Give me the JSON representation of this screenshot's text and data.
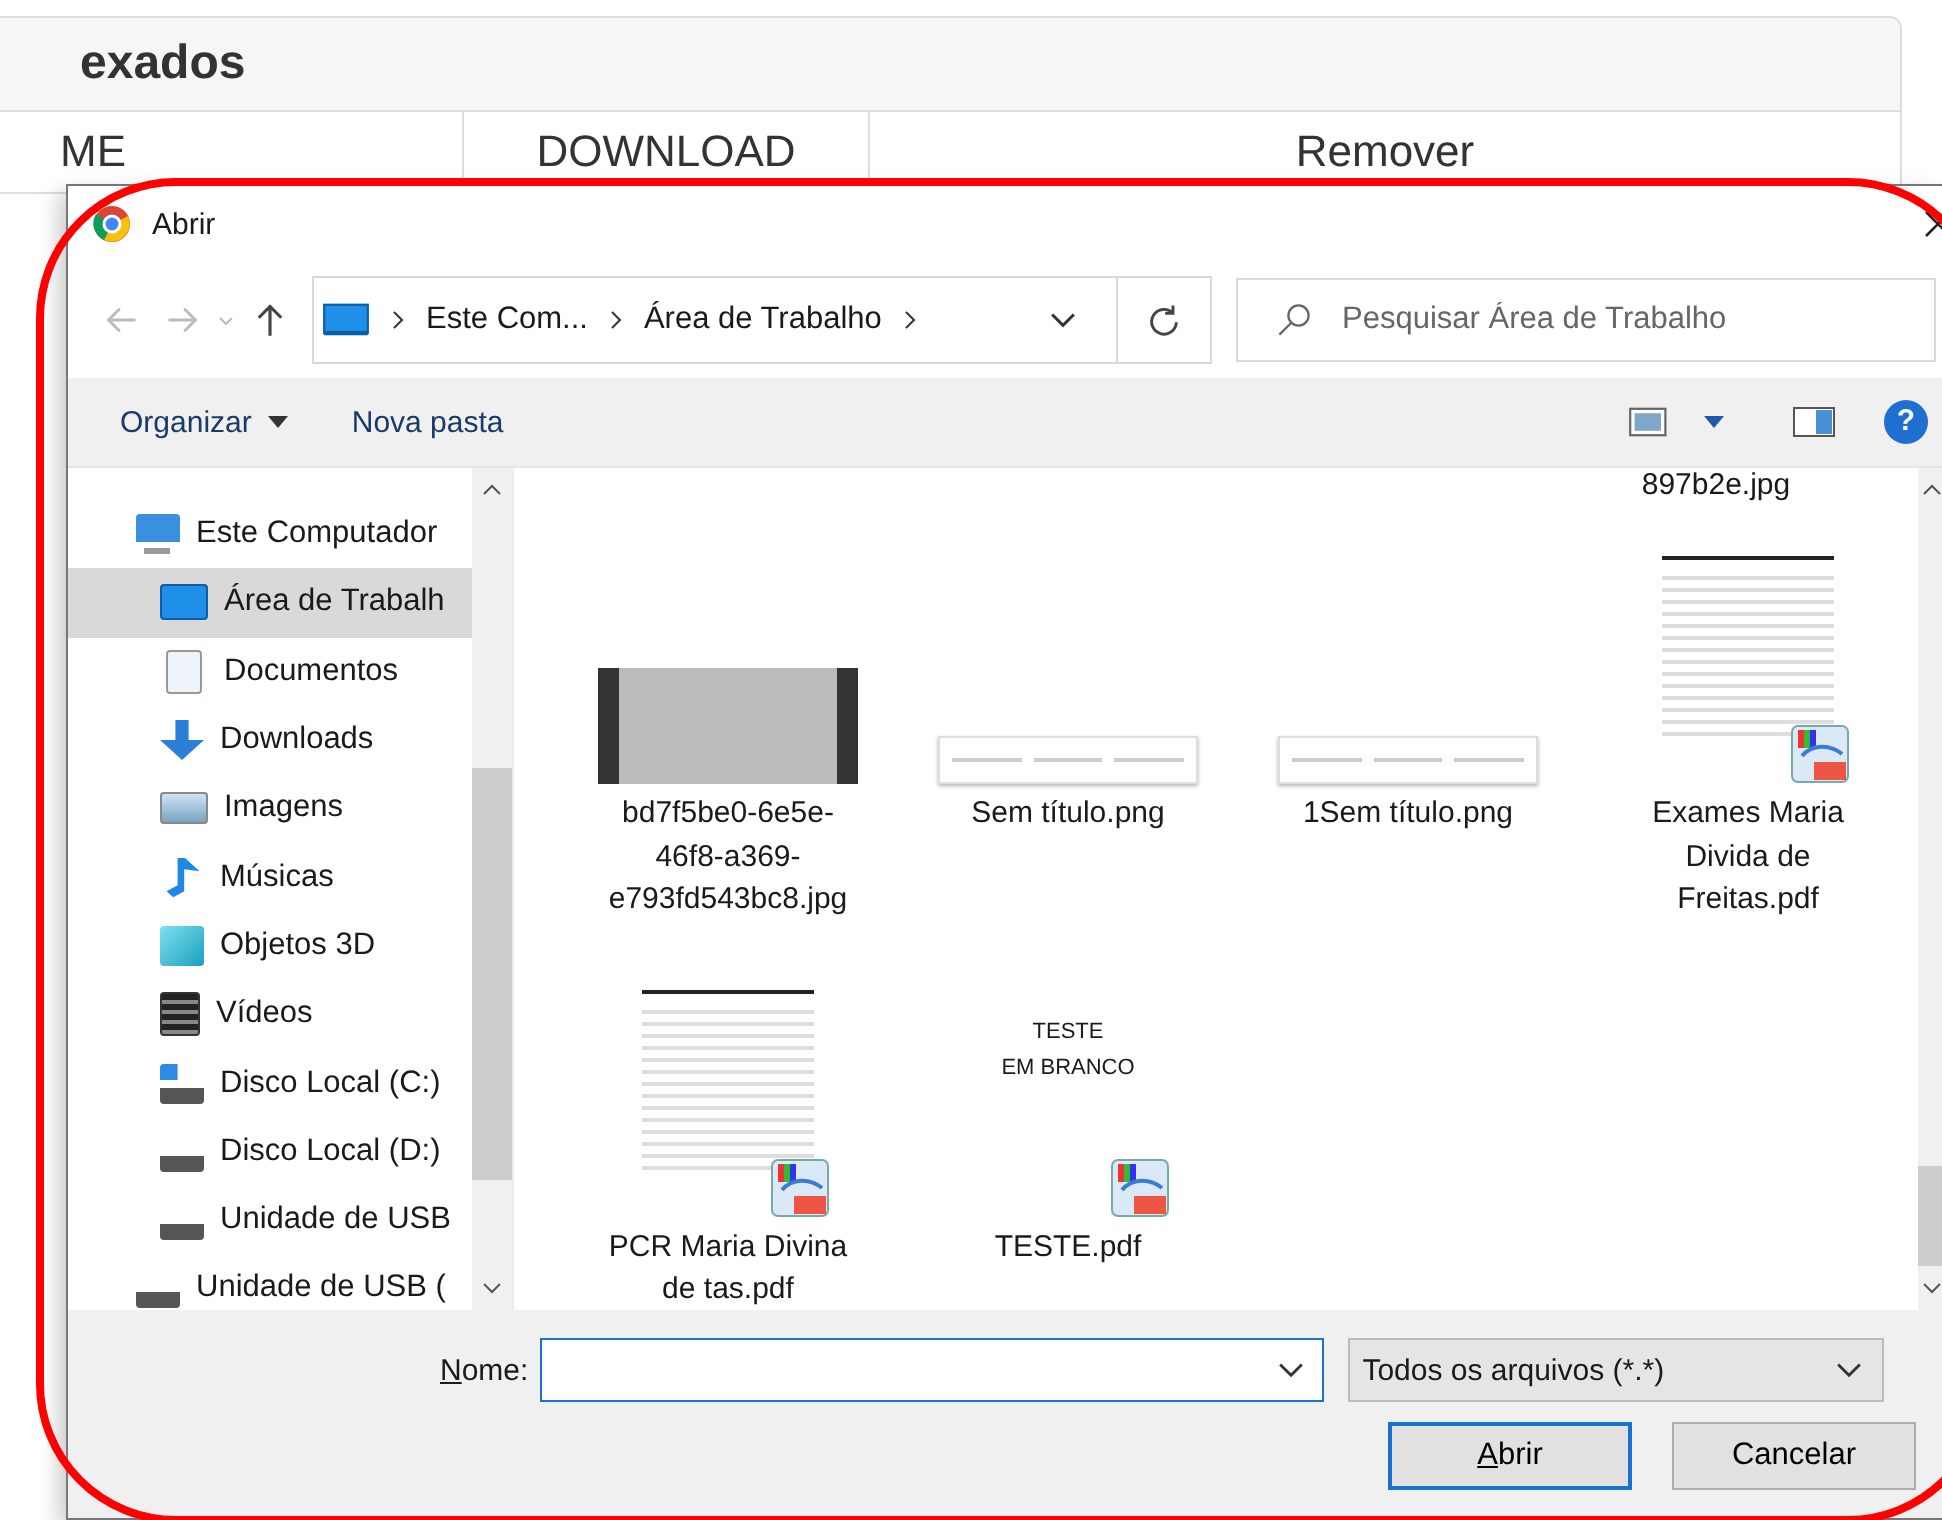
{
  "background_page": {
    "heading": "exados",
    "columns": [
      "ME",
      "DOWNLOAD",
      "Remover"
    ]
  },
  "dialog": {
    "title": "Abrir",
    "breadcrumb": [
      "Este Com...",
      "Área de Trabalho"
    ],
    "search": {
      "placeholder": "Pesquisar Área de Trabalho"
    },
    "toolbar": [
      {
        "label": "Organizar",
        "kind": "menu"
      },
      {
        "label": "Nova pasta",
        "kind": "button"
      }
    ],
    "help": "?",
    "nav": [
      {
        "label": "Este Computador",
        "kind": "computer",
        "selected": false,
        "children": [
          {
            "label": "Área de Trabalh",
            "kind": "desktop",
            "selected": true
          },
          {
            "label": "Documentos",
            "kind": "documents",
            "selected": false
          },
          {
            "label": "Downloads",
            "kind": "downloads",
            "selected": false
          },
          {
            "label": "Imagens",
            "kind": "pictures",
            "selected": false
          },
          {
            "label": "Músicas",
            "kind": "music",
            "selected": false
          },
          {
            "label": "Objetos 3D",
            "kind": "objects",
            "selected": false
          },
          {
            "label": "Vídeos",
            "kind": "videos",
            "selected": false
          },
          {
            "label": "Disco Local (C:)",
            "kind": "system-drive",
            "selected": false
          },
          {
            "label": "Disco Local (D:)",
            "kind": "drive",
            "selected": false
          },
          {
            "label": "Unidade de USB",
            "kind": "drive",
            "selected": false
          }
        ]
      },
      {
        "label": "Unidade de USB (",
        "kind": "drive",
        "selected": false
      }
    ],
    "files": [
      {
        "name": "897b2e.jpg",
        "kind": "partial"
      },
      {
        "name": "bd7f5be0-6e5e-46f8-a369-e793fd543bc8.jpg",
        "kind": "photo"
      },
      {
        "name": "Sem título.png",
        "kind": "screenshot"
      },
      {
        "name": "1Sem título.png",
        "kind": "screenshot"
      },
      {
        "name": "Exames Maria Divida de Freitas.pdf",
        "kind": "pdf-doc"
      },
      {
        "name": "PCR Maria Divina de tas.pdf",
        "kind": "pdf-doc"
      },
      {
        "name": "TESTE.pdf",
        "kind": "pdf-text",
        "thumb_lines": [
          "TESTE",
          "EM BRANCO"
        ]
      }
    ],
    "filename": {
      "label": "Nome:"
    },
    "filetype": "Todos os arquivos (*.*)",
    "buttons": [
      {
        "label": "Abrir",
        "kind": "primary"
      },
      {
        "label": "Cancelar",
        "kind": "normal"
      }
    ]
  }
}
